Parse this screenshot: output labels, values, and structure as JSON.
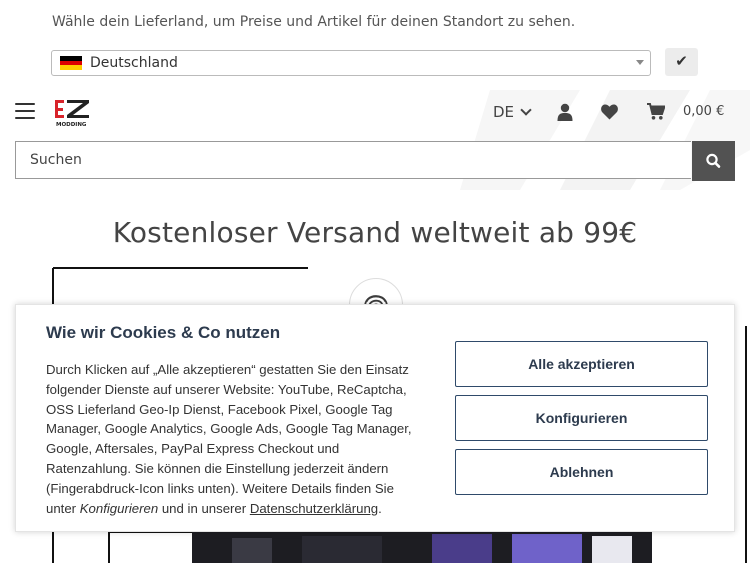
{
  "country_bar": {
    "message": "Wähle dein Lieferland, um Preise und Artikel für deinen Standort zu sehen.",
    "selected_country": "Deutschland",
    "confirm_symbol": "✔"
  },
  "header": {
    "logo_text": "EZ",
    "logo_subtext": "MODDING",
    "language": "DE",
    "cart_total": "0,00 €",
    "icons": [
      "menu-icon",
      "user-icon",
      "heart-icon",
      "cart-icon",
      "search-icon"
    ]
  },
  "search": {
    "placeholder": "Suchen"
  },
  "promo": {
    "headline": "Kostenloser Versand weltweit ab 99€"
  },
  "cookie": {
    "title": "Wie wir Cookies & Co nutzen",
    "text_1": "Durch Klicken auf „Alle akzeptieren“ gestatten Sie den Einsatz folgender Dienste auf unserer Website: YouTube, ReCaptcha, OSS Lieferland Geo-Ip Dienst, Facebook Pixel, Google Tag Manager, Google Analytics, Google Ads, Google Tag Manager, Google, Aftersales, PayPal Express Checkout und Ratenzahlung. Sie können die Einstellung jederzeit ändern (Fingerabdruck-Icon links unten). Weitere Details finden Sie unter ",
    "text_configure_em": "Konfigurieren",
    "text_2": " und in unserer ",
    "privacy_link": "Datenschutzerklärung",
    "text_3": ".",
    "buttons": {
      "accept_all": "Alle akzeptieren",
      "configure": "Konfigurieren",
      "decline": "Ablehnen"
    }
  },
  "colors": {
    "accent_dark": "#2d3b4e",
    "search_button": "#525252",
    "logo_red": "#d8232a",
    "flag_black": "#000000",
    "flag_red": "#dd0000",
    "flag_gold": "#ffce00"
  }
}
